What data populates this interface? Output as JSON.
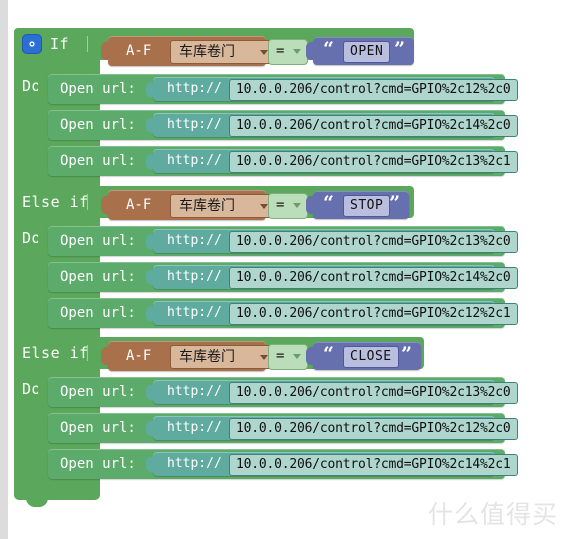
{
  "editor": {
    "watermark": "什么值得买",
    "gear_icon": "gear-icon",
    "colors": {
      "control_block": "#5ba75b",
      "statement_block": "#5cab6a",
      "variable_block": "#a9714b",
      "string_block": "#6670ae",
      "url_block": "#5fab9f",
      "operator_block": "#bcddb9",
      "gear_badge": "#2b6fd4",
      "left_strip": "#dcdcdc",
      "watermark_text": "#e4e4e4"
    }
  },
  "block": {
    "keywords": {
      "if": "If",
      "else_if": "Else if",
      "do": "Do"
    },
    "statement_label": "Open  url:",
    "protocol": "http://"
  },
  "branches": [
    {
      "keyword": "If",
      "condition": {
        "variable_label": "A-F",
        "variable_value": "车库卷门",
        "operator": "=",
        "compare_value": "OPEN"
      },
      "do_label": "Do",
      "statements": [
        {
          "label": "Open  url:",
          "protocol": "http://",
          "url": "10.0.0.206/control?cmd=GPIO%2c12%2c0"
        },
        {
          "label": "Open  url:",
          "protocol": "http://",
          "url": "10.0.0.206/control?cmd=GPIO%2c14%2c0"
        },
        {
          "label": "Open  url:",
          "protocol": "http://",
          "url": "10.0.0.206/control?cmd=GPIO%2c13%2c1"
        }
      ]
    },
    {
      "keyword": "Else if",
      "condition": {
        "variable_label": "A-F",
        "variable_value": "车库卷门",
        "operator": "=",
        "compare_value": "STOP"
      },
      "do_label": "Do",
      "statements": [
        {
          "label": "Open  url:",
          "protocol": "http://",
          "url": "10.0.0.206/control?cmd=GPIO%2c13%2c0"
        },
        {
          "label": "Open  url:",
          "protocol": "http://",
          "url": "10.0.0.206/control?cmd=GPIO%2c14%2c0"
        },
        {
          "label": "Open  url:",
          "protocol": "http://",
          "url": "10.0.0.206/control?cmd=GPIO%2c12%2c1"
        }
      ]
    },
    {
      "keyword": "Else if",
      "condition": {
        "variable_label": "A-F",
        "variable_value": "车库卷门",
        "operator": "=",
        "compare_value": "CLOSE"
      },
      "do_label": "Do",
      "statements": [
        {
          "label": "Open  url:",
          "protocol": "http://",
          "url": "10.0.0.206/control?cmd=GPIO%2c13%2c0"
        },
        {
          "label": "Open  url:",
          "protocol": "http://",
          "url": "10.0.0.206/control?cmd=GPIO%2c12%2c0"
        },
        {
          "label": "Open  url:",
          "protocol": "http://",
          "url": "10.0.0.206/control?cmd=GPIO%2c14%2c1"
        }
      ]
    }
  ]
}
